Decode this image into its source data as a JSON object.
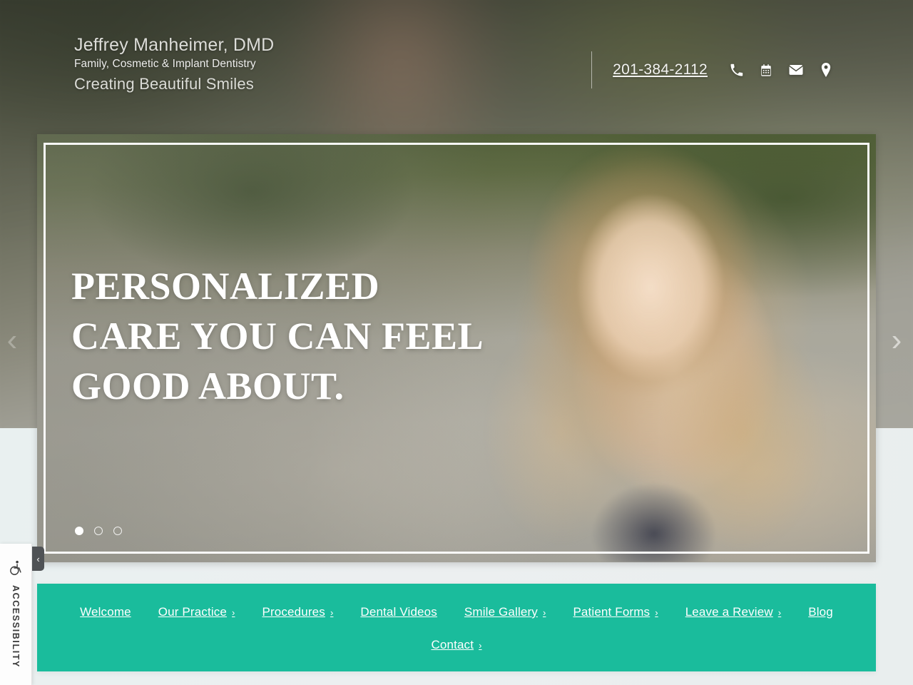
{
  "header": {
    "brand_name": "Jeffrey Manheimer, DMD",
    "brand_tagline": "Family, Cosmetic & Implant Dentistry",
    "brand_slogan": "Creating Beautiful Smiles",
    "phone": "201-384-2112",
    "icons": [
      {
        "name": "phone-icon",
        "label": "Call"
      },
      {
        "name": "calendar-icon",
        "label": "Request Appointment"
      },
      {
        "name": "envelope-icon",
        "label": "Email"
      },
      {
        "name": "map-pin-icon",
        "label": "Location"
      }
    ]
  },
  "slider": {
    "caption_lines": [
      "PERSONALIZED",
      "CARE YOU CAN FEEL",
      "GOOD ABOUT."
    ],
    "dots": [
      {
        "index": 1,
        "active": true
      },
      {
        "index": 2,
        "active": false
      },
      {
        "index": 3,
        "active": false
      }
    ],
    "prev_arrow": "‹",
    "next_arrow": "›"
  },
  "nav": {
    "row1": [
      {
        "label": "Welcome",
        "caret": ""
      },
      {
        "label": "Our Practice",
        "caret": "›"
      },
      {
        "label": "Procedures",
        "caret": "›"
      },
      {
        "label": "Dental Videos",
        "caret": ""
      },
      {
        "label": "Smile Gallery",
        "caret": "›"
      },
      {
        "label": "Patient Forms",
        "caret": "›"
      },
      {
        "label": "Leave a Review",
        "caret": "›"
      },
      {
        "label": "Blog",
        "caret": ""
      }
    ],
    "row2": [
      {
        "label": "Contact",
        "caret": "›"
      }
    ]
  },
  "accessibility": {
    "label": "Accessibility",
    "toggle_glyph": "‹"
  },
  "colors": {
    "nav_teal": "#1abc9c",
    "page_background": "#eaf0f0",
    "text_white": "#ffffff",
    "a11y_dark": "#4f5255"
  }
}
